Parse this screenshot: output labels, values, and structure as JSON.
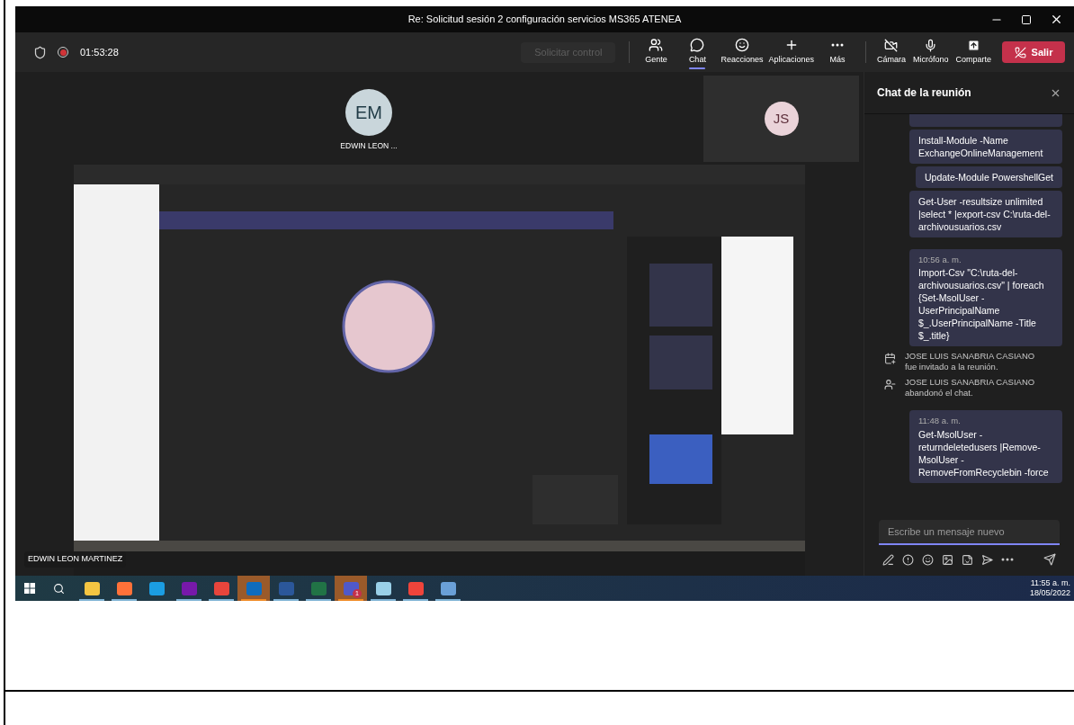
{
  "window": {
    "title": "Re: Solicitud sesión 2 configuración servicios MS365 ATENEA"
  },
  "meeting_bar": {
    "timer": "01:53:28",
    "recording": true,
    "request_control": {
      "label": "Solicitar control",
      "disabled": true
    },
    "tools": [
      {
        "kind": "people",
        "label": "Gente",
        "selected": false
      },
      {
        "kind": "chat",
        "label": "Chat",
        "selected": true
      },
      {
        "kind": "reactions",
        "label": "Reacciones",
        "selected": false
      },
      {
        "kind": "apps",
        "label": "Aplicaciones",
        "selected": false
      },
      {
        "kind": "more",
        "label": "Más",
        "selected": false
      }
    ],
    "devices": [
      {
        "kind": "camera",
        "label": "Cámara",
        "on": false
      },
      {
        "kind": "mic",
        "label": "Micrófono",
        "on": true
      },
      {
        "kind": "share",
        "label": "Comparte",
        "on": false
      }
    ],
    "leave": "Salir"
  },
  "participants": [
    {
      "kind": "main",
      "initials": "EM",
      "name": "EDWIN LEON ..."
    },
    {
      "kind": "tile",
      "initials": "JS"
    }
  ],
  "shared_screen": {
    "kind": "picture",
    "presenter": "EDWIN LEON MARTINEZ"
  },
  "chat": {
    "title": "Chat de la reunión",
    "messages": [
      {
        "kind": "clipped"
      },
      {
        "kind": "message",
        "text": "Install-Module -Name ExchangeOnlineManagement"
      },
      {
        "kind": "message",
        "text": "Update-Module PowershellGet",
        "narrow": true
      },
      {
        "kind": "message",
        "text": "Get-User -resultsize unlimited |select * |export-csv C:\\ruta-del-archivousuarios.csv"
      },
      {
        "kind": "message",
        "time": "10:56 a. m.",
        "text": "Import-Csv \"C:\\ruta-del-archivousuarios.csv\" | foreach {Set-MsolUser -UserPrincipalName $_.UserPrincipalName -Title $_.title}"
      },
      {
        "kind": "invited",
        "name": "JOSE LUIS SANABRIA CASIANO",
        "action": "fue invitado a la reunión."
      },
      {
        "kind": "left",
        "name": "JOSE LUIS SANABRIA CASIANO",
        "action": "abandonó el chat."
      },
      {
        "kind": "message",
        "time": "11:48 a. m.",
        "text": "Get-MsolUser -returndeletedusers |Remove-MsolUser -RemoveFromRecyclebin -force"
      }
    ],
    "compose": {
      "placeholder": "Escribe un mensaje nuevo"
    }
  },
  "taskbar": {
    "apps": [
      {
        "kind": "explorer",
        "running": true,
        "highlighted": false
      },
      {
        "kind": "firefox",
        "running": true,
        "highlighted": false
      },
      {
        "kind": "edge",
        "running": false,
        "highlighted": false
      },
      {
        "kind": "onenote",
        "running": true,
        "highlighted": false
      },
      {
        "kind": "chrome",
        "running": true,
        "highlighted": false
      },
      {
        "kind": "outlook",
        "running": true,
        "highlighted": true
      },
      {
        "kind": "word",
        "running": true,
        "highlighted": false
      },
      {
        "kind": "excel",
        "running": true,
        "highlighted": false
      },
      {
        "kind": "teams",
        "running": true,
        "highlighted": true,
        "badge": "1"
      },
      {
        "kind": "notepad",
        "running": true,
        "highlighted": false
      },
      {
        "kind": "anydesk",
        "running": true,
        "highlighted": false
      },
      {
        "kind": "remote",
        "running": true,
        "highlighted": false
      }
    ],
    "time": "11:55 a. m.",
    "date": "18/05/2022"
  }
}
